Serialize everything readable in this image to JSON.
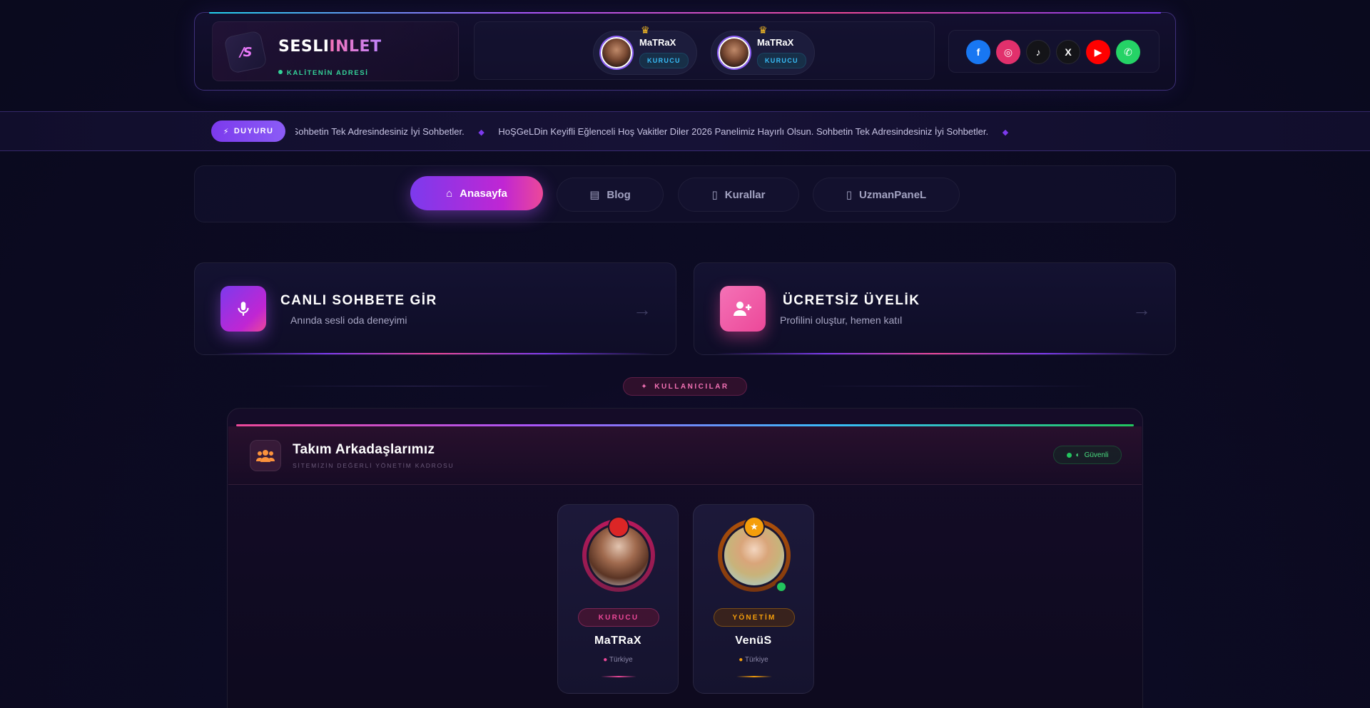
{
  "brand": {
    "title_part1": "SESLI",
    "title_part2": "INLET",
    "tagline": "KALİTENİN ADRESİ",
    "mark": "/S"
  },
  "header_admins": [
    {
      "name": "MaTRaX",
      "role": "KURUCU",
      "crown": "♛"
    },
    {
      "name": "MaTRaX",
      "role": "KURUCU",
      "crown": "♛"
    }
  ],
  "social": [
    {
      "name": "facebook",
      "glyph": "f",
      "color": "#1877f2"
    },
    {
      "name": "instagram",
      "glyph": "◎",
      "color": "#e1306c"
    },
    {
      "name": "tiktok",
      "glyph": "♪",
      "color": "#111111"
    },
    {
      "name": "x",
      "glyph": "X",
      "color": "#111111"
    },
    {
      "name": "youtube",
      "glyph": "▶",
      "color": "#ff0000"
    },
    {
      "name": "whatsapp",
      "glyph": "✆",
      "color": "#25d366"
    }
  ],
  "announcement": {
    "badge": "DUYURU",
    "text1": "HoŞGeLDin Keyifli Eğlenceli Hoş Vakitler Diler 2026 Panelimiz Hayırlı Olsun. Sohbetin Tek Adresindesiniz İyi Sohbetler.",
    "text2": "HoŞGeLDin Keyifli Eğlenceli Hoş Vakitler Diler 2026 Panelimiz Hayırlı Olsun. Sohbetin Tek Adresindesiniz İyi Sohbetler."
  },
  "nav": [
    {
      "label": "Anasayfa",
      "icon": "home-icon",
      "active": true
    },
    {
      "label": "Blog",
      "icon": "newspaper-icon",
      "active": false
    },
    {
      "label": "Kurallar",
      "icon": "document-icon",
      "active": false
    },
    {
      "label": "UzmanPaneL",
      "icon": "document-icon",
      "active": false
    }
  ],
  "cta": {
    "chat_title": "CANLI SOHBETE GİR",
    "chat_sub": "Anında sesli oda deneyimi",
    "signup_title": "ÜCRETSİZ ÜYELİK",
    "signup_sub": "Profilini oluştur, hemen katıl"
  },
  "users_section": {
    "pill": "KULLANICILAR"
  },
  "team": {
    "title": "Takım Arkadaşlarımız",
    "subtitle": "SİTEMİZİN DEĞERLİ YÖNETİM KADROSU",
    "badge": "Güvenli",
    "members": [
      {
        "name": "MaTRaX",
        "role": "KURUCU",
        "location": "Türkiye",
        "role_color": "#ec4899"
      },
      {
        "name": "VenüS",
        "role": "YÖNETİM",
        "location": "Türkiye",
        "role_color": "#f59e0b"
      }
    ]
  },
  "colors": {
    "accent_purple": "#7c3aed",
    "accent_pink": "#ec4899",
    "online": "#22c55e"
  }
}
